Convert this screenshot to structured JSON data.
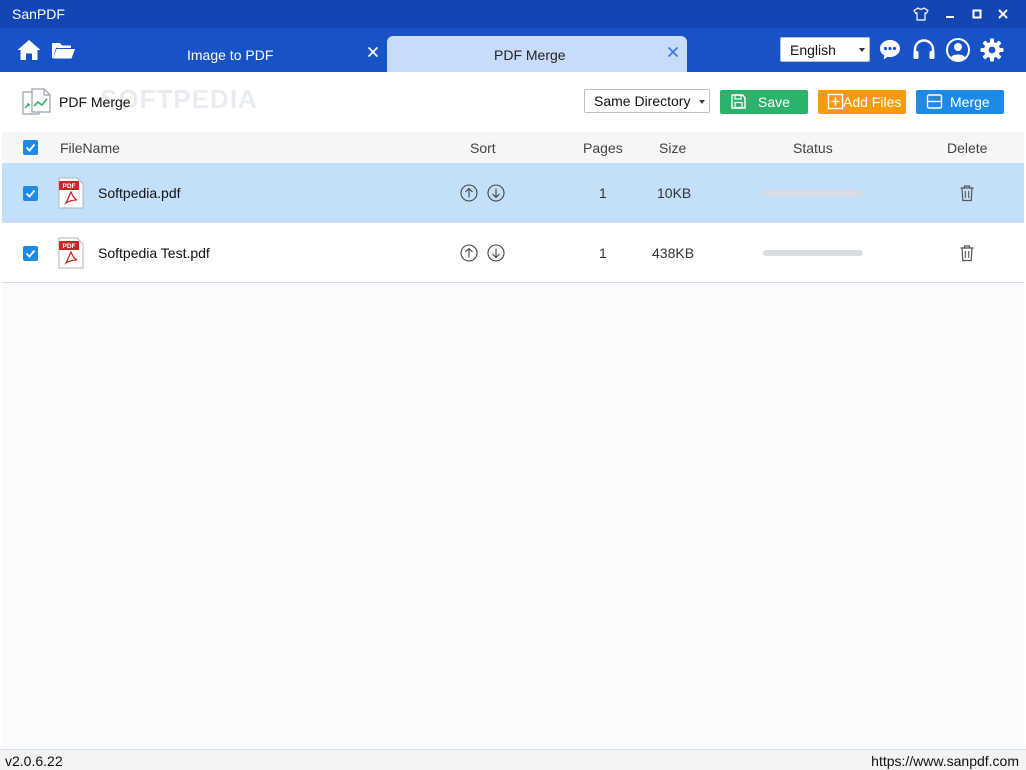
{
  "window": {
    "title": "SanPDF"
  },
  "tabs": [
    {
      "label": "Image to PDF",
      "active": false
    },
    {
      "label": "PDF Merge",
      "active": true
    }
  ],
  "header": {
    "language": "English"
  },
  "toolbar": {
    "title": "PDF Merge",
    "watermark": "SOFTPEDIA",
    "directory": "Same Directory",
    "save_label": "Save",
    "add_label": "Add Files",
    "merge_label": "Merge"
  },
  "table": {
    "columns": {
      "filename": "FileName",
      "sort": "Sort",
      "pages": "Pages",
      "size": "Size",
      "status": "Status",
      "delete": "Delete"
    },
    "rows": [
      {
        "name": "Softpedia.pdf",
        "pages": "1",
        "size": "10KB",
        "progress": 0,
        "selected": true
      },
      {
        "name": "Softpedia Test.pdf",
        "pages": "1",
        "size": "438KB",
        "progress": 0,
        "selected": false
      }
    ]
  },
  "status": {
    "version": "v2.0.6.22",
    "url": "https://www.sanpdf.com"
  },
  "colors": {
    "titlebar": "#1346b4",
    "tabbar": "#1753c6",
    "active_tab": "#c6dcfa",
    "selected_row": "#c2e0fa",
    "save": "#2bb36b",
    "add": "#f59b0c",
    "merge": "#1e8ae6"
  },
  "icons": {
    "home": "home-icon",
    "folder": "folder-icon",
    "skin": "tshirt-icon",
    "chat": "chat-icon",
    "support": "headset-icon",
    "user": "user-icon",
    "settings": "gear-icon",
    "pdf": "pdf-file-icon",
    "trash": "trash-icon"
  }
}
